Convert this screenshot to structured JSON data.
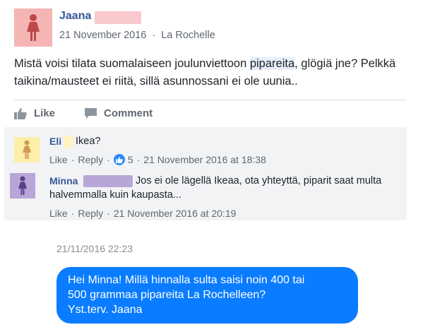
{
  "post": {
    "author": "Jaana",
    "date": "21 November 2016",
    "separator": "·",
    "location": "La Rochelle",
    "text_before": "Mistä voisi tilata suomalaiseen joulunviettoon ",
    "text_highlight": "pipareita",
    "text_after": ", glögiä jne? Pelkkä taikina/mausteet ei riitä, sillä asunnossani ei ole uunia..",
    "like_label": "Like",
    "comment_label": "Comment",
    "avatar_color": "#f5b5b5",
    "avatar_figure_color": "#c0474a"
  },
  "comments": [
    {
      "author": "Eli",
      "text": "Ikea?",
      "like": "Like",
      "reply": "Reply",
      "reactions": "5",
      "time": "21 November 2016 at 18:38",
      "avatar_color": "#fdeea8",
      "avatar_figure_color": "#d29a55",
      "redact_color": "#fff4bf"
    },
    {
      "author": "Minna",
      "text_line1": "Jos ei ole lägellä Ikeaa, ota yhteyttä, piparit saat multa",
      "text_line2": "halvemmalla kuin kaupasta...",
      "like": "Like",
      "reply": "Reply",
      "time": "21 November 2016 at 20:19",
      "avatar_color": "#b9a6d9",
      "avatar_figure_color": "#5a3f86",
      "redact_color": "#b9a6d9"
    }
  ],
  "message": {
    "timestamp": "21/11/2016 22:23",
    "line1": "Hei Minna! Millä hinnalla sulta saisi noin 400 tai",
    "line2": "500 grammaa pipareita La Rochelleen?",
    "line3": "Yst.terv. Jaana",
    "bubble_color": "#0a7cff"
  },
  "dot": "·"
}
